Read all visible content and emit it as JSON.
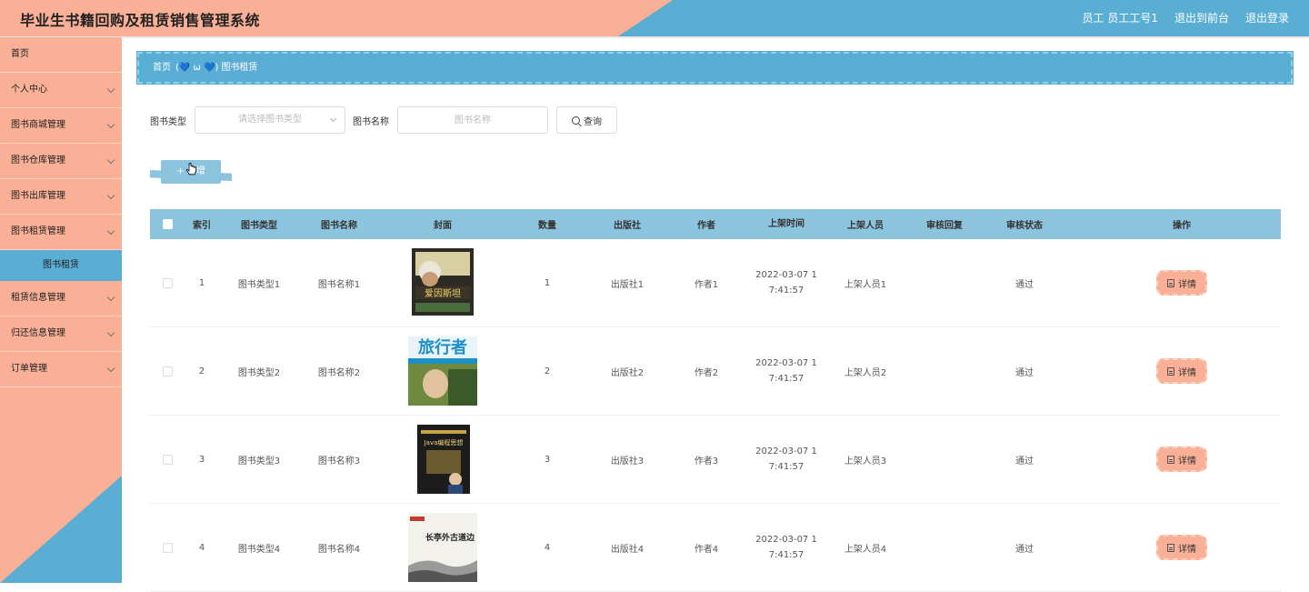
{
  "header": {
    "title": "毕业生书籍回购及租赁销售管理系统",
    "user_label": "员工 员工工号1",
    "to_front_label": "退出到前台",
    "logout_label": "退出登录"
  },
  "sidebar": {
    "items": [
      {
        "label": "首页",
        "has_arrow": false
      },
      {
        "label": "个人中心",
        "has_arrow": true
      },
      {
        "label": "图书商城管理",
        "has_arrow": true
      },
      {
        "label": "图书仓库管理",
        "has_arrow": true
      },
      {
        "label": "图书出库管理",
        "has_arrow": true
      },
      {
        "label": "图书租赁管理",
        "has_arrow": true
      },
      {
        "label": "租赁信息管理",
        "has_arrow": true
      },
      {
        "label": "归还信息管理",
        "has_arrow": true
      },
      {
        "label": "订单管理",
        "has_arrow": true
      }
    ],
    "active_sub": "图书租赁"
  },
  "breadcrumb": {
    "home": "首页",
    "separator": "(💙 ω 💙)",
    "current": "图书租赁"
  },
  "search": {
    "type_label": "图书类型",
    "type_placeholder": "请选择图书类型",
    "name_label": "图书名称",
    "name_placeholder": "图书名称",
    "query_label": "查询"
  },
  "toolbar": {
    "add_label": "+ 新增"
  },
  "table": {
    "headers": [
      "索引",
      "图书类型",
      "图书名称",
      "封面",
      "数量",
      "出版社",
      "作者",
      "上架时间",
      "上架人员",
      "审核回复",
      "审核状态",
      "操作"
    ],
    "detail_label": "详情",
    "rows": [
      {
        "index": "1",
        "type": "图书类型1",
        "name": "图书名称1",
        "qty": "1",
        "publisher": "出版社1",
        "author": "作者1",
        "time_a": "2022-03-07 1",
        "time_b": "7:41:57",
        "staff": "上架人员1",
        "reply": "",
        "status": "通过",
        "cover_text": "爱因斯坦"
      },
      {
        "index": "2",
        "type": "图书类型2",
        "name": "图书名称2",
        "qty": "2",
        "publisher": "出版社2",
        "author": "作者2",
        "time_a": "2022-03-07 1",
        "time_b": "7:41:57",
        "staff": "上架人员2",
        "reply": "",
        "status": "通过",
        "cover_text": "旅行者"
      },
      {
        "index": "3",
        "type": "图书类型3",
        "name": "图书名称3",
        "qty": "3",
        "publisher": "出版社3",
        "author": "作者3",
        "time_a": "2022-03-07 1",
        "time_b": "7:41:57",
        "staff": "上架人员3",
        "reply": "",
        "status": "通过",
        "cover_text": "Java编程思想"
      },
      {
        "index": "4",
        "type": "图书类型4",
        "name": "图书名称4",
        "qty": "4",
        "publisher": "出版社4",
        "author": "作者4",
        "time_a": "2022-03-07 1",
        "time_b": "7:41:57",
        "staff": "上架人员4",
        "reply": "",
        "status": "通过",
        "cover_text": "长亭外古道边"
      }
    ]
  },
  "colors": {
    "salmon": "#f9b097",
    "blue": "#5aaed4",
    "table_header": "#8cc4de"
  }
}
